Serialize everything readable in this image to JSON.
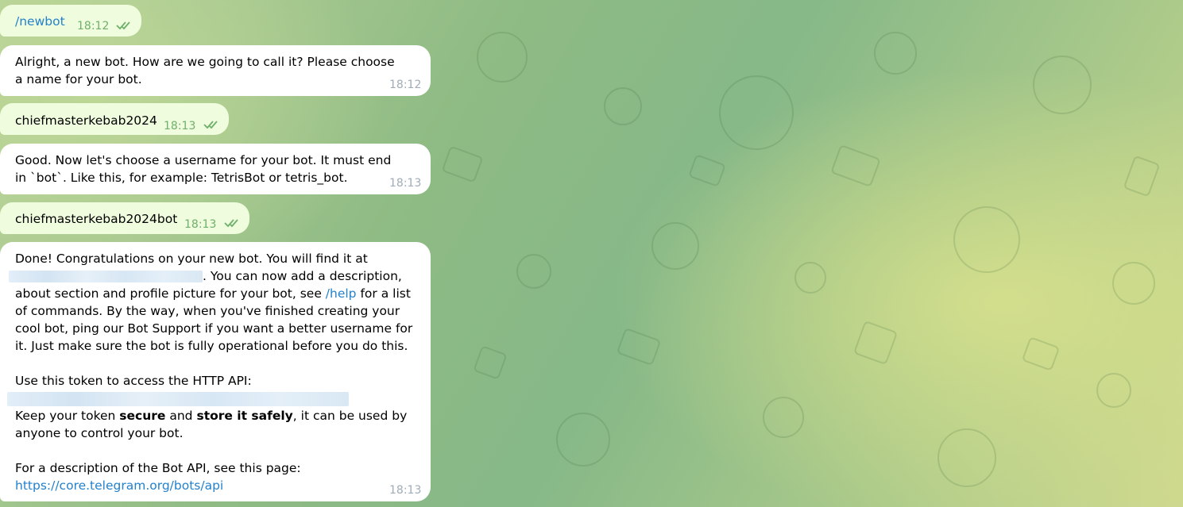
{
  "messages": [
    {
      "text": "/newbot",
      "time": "18:12"
    },
    {
      "text": "Alright, a new bot. How are we going to call it? Please choose a name for your bot.",
      "time": "18:12"
    },
    {
      "text": "chiefmasterkebab2024",
      "time": "18:13"
    },
    {
      "text": "Good. Now let's choose a username for your bot. It must end in `bot`. Like this, for example: TetrisBot or tetris_bot.",
      "time": "18:13"
    },
    {
      "text": "chiefmasterkebab2024bot",
      "time": "18:13"
    },
    {
      "time": "18:13",
      "p1_a": "Done! Congratulations on your new bot. You will find it at",
      "p1_b": ". You can now add a description, about section and profile picture for your bot, see",
      "help_link": "/help",
      "p1_c": "for a list of commands. By the way, when you've finished creating your cool bot, ping our Bot Support if you want a better username for it. Just make sure the bot is fully operational before you do this.",
      "p2": "Use this token to access the HTTP API:",
      "p3_a": "Keep your token",
      "p3_b": "secure",
      "p3_c": "and",
      "p3_d": "store it safely",
      "p3_e": ", it can be used by anyone to control your bot.",
      "p4": "For a description of the Bot API, see this page:",
      "api_link": "https://core.telegram.org/bots/api"
    }
  ],
  "colors": {
    "outgoing_bubble": "#effdde",
    "incoming_bubble": "#ffffff",
    "link": "#2481cc",
    "read_check": "#6fb06a"
  }
}
